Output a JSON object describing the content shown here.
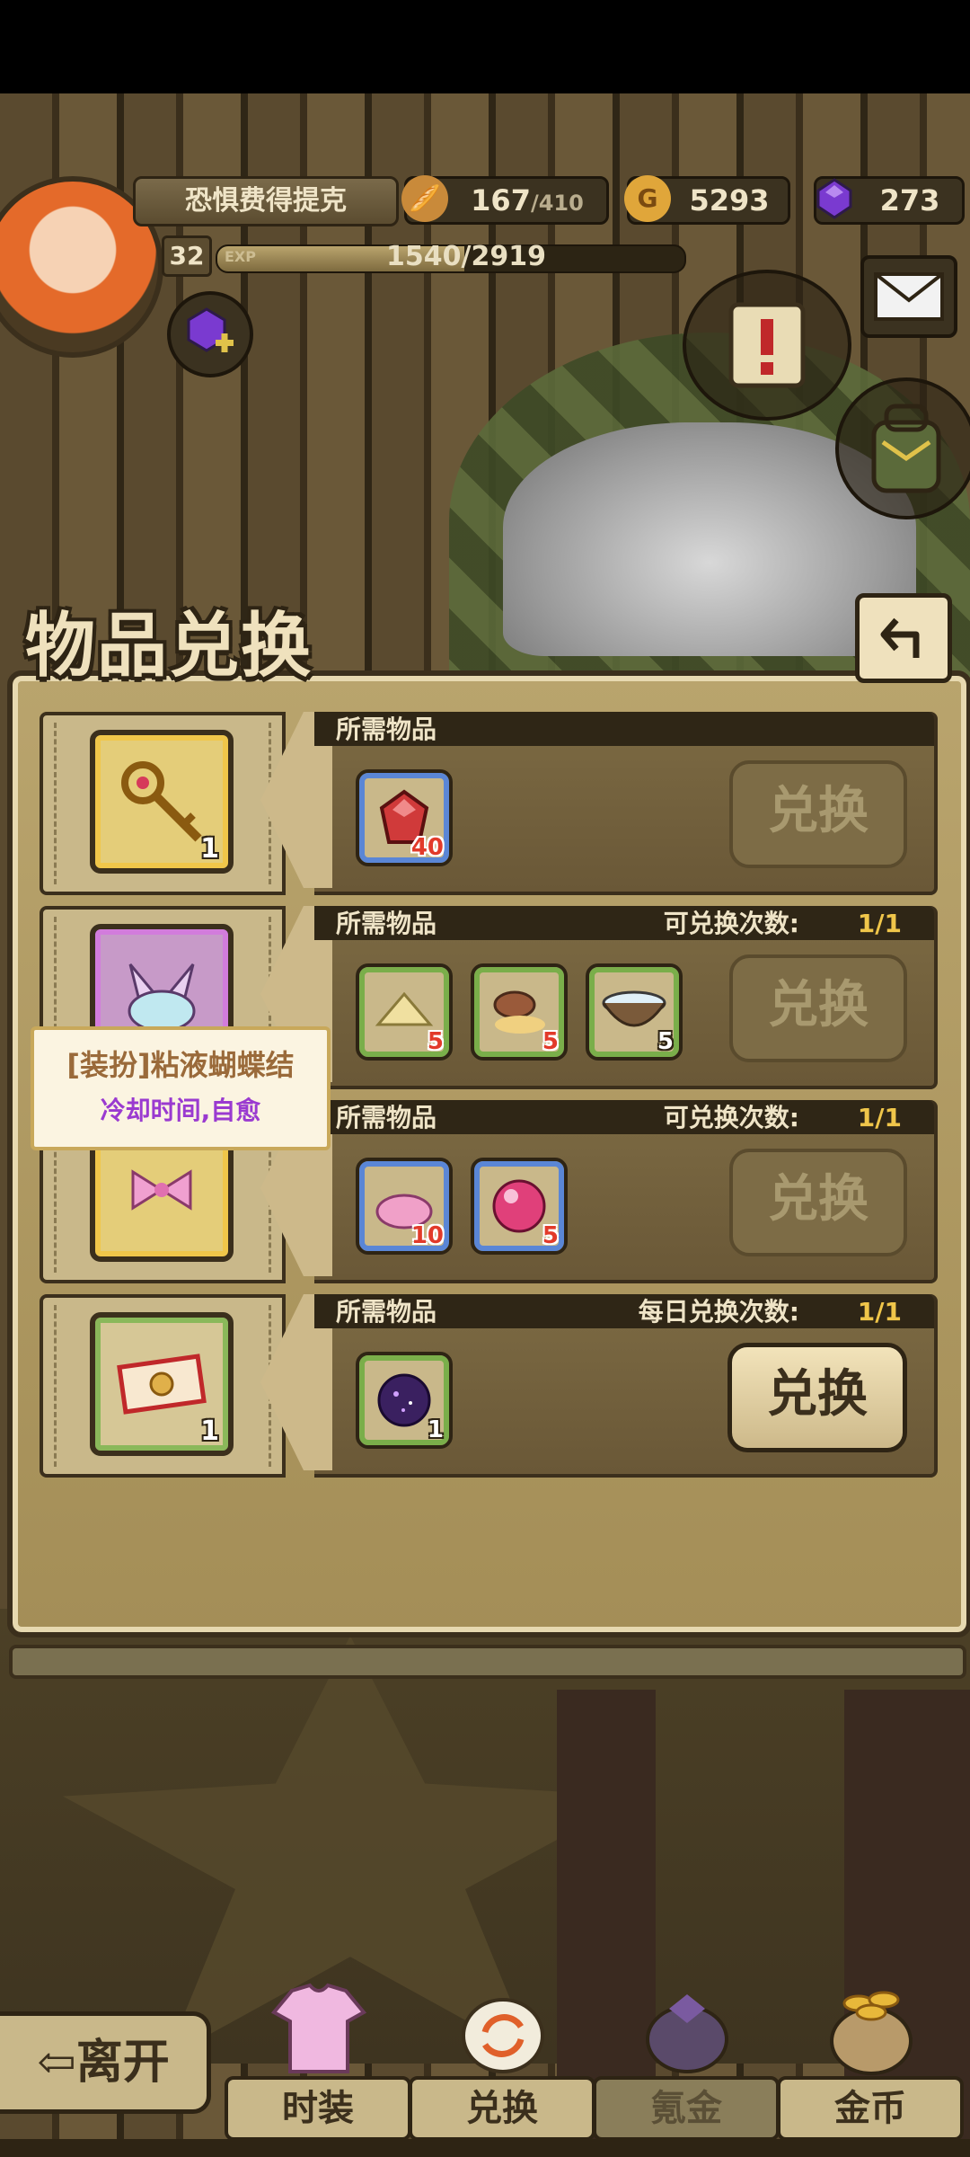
{
  "header": {
    "player_name": "恐惧费得提克",
    "level": "32",
    "exp_label": "EXP",
    "exp_value": "1540/2919",
    "exp_fraction": 0.528,
    "stamina": "167",
    "stamina_max": "/410",
    "gold_icon": "G",
    "gold": "5293",
    "gems": "273"
  },
  "panel": {
    "title": "物品兑换",
    "rows": [
      {
        "required_label": "所需物品",
        "count_label": "",
        "count_value": "",
        "reward_count": "1",
        "requirements": [
          {
            "icon": "red-crystal-icon",
            "count": "40"
          }
        ],
        "button": "兑换",
        "enabled": false
      },
      {
        "required_label": "所需物品",
        "count_label": "可兑换次数:",
        "count_value": "1/1",
        "reward_count": "",
        "requirements": [
          {
            "icon": "flour-icon",
            "count": "5"
          },
          {
            "icon": "mushroom-icon",
            "count": "5"
          },
          {
            "icon": "bowl-icon",
            "count": "5"
          }
        ],
        "button": "兑换",
        "enabled": false
      },
      {
        "required_label": "所需物品",
        "count_label": "可兑换次数:",
        "count_value": "1/1",
        "reward_count": "",
        "requirements": [
          {
            "icon": "pink-slime-icon",
            "count": "10"
          },
          {
            "icon": "pink-orb-icon",
            "count": "5"
          }
        ],
        "button": "兑换",
        "enabled": false
      },
      {
        "required_label": "所需物品",
        "count_label": "每日兑换次数:",
        "count_value": "1/1",
        "reward_count": "1",
        "requirements": [
          {
            "icon": "cosmic-stone-icon",
            "count": "1"
          }
        ],
        "button": "兑换",
        "enabled": true
      }
    ]
  },
  "tooltip": {
    "title": "[装扮]粘液蝴蝶结",
    "desc": "冷却时间,自愈"
  },
  "nav": {
    "leave": "离开",
    "tabs": [
      "时装",
      "兑换",
      "氪金",
      "金币"
    ]
  }
}
